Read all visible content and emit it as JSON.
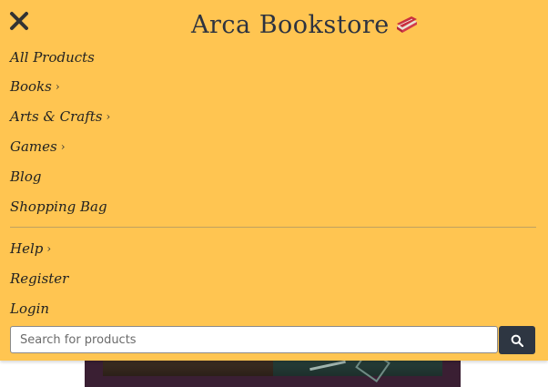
{
  "brand": {
    "name": "Arca Bookstore",
    "icon": "book-icon"
  },
  "close": {
    "icon": "close-icon"
  },
  "menu": {
    "items": [
      {
        "label": "All Products"
      },
      {
        "label": "Books",
        "chevron": "›"
      },
      {
        "label": "Arts & Crafts",
        "chevron": "›"
      },
      {
        "label": "Games",
        "chevron": "›"
      },
      {
        "label": "Blog"
      },
      {
        "label": "Shopping Bag"
      }
    ],
    "secondary": [
      {
        "label": "Help",
        "chevron": "›"
      },
      {
        "label": "Register"
      },
      {
        "label": "Login"
      }
    ]
  },
  "search": {
    "placeholder": "Search for products",
    "value": "",
    "icon": "search-icon"
  },
  "colors": {
    "menu_bg": "#ffc551",
    "search_button": "#2e3642",
    "text": "#222222"
  }
}
